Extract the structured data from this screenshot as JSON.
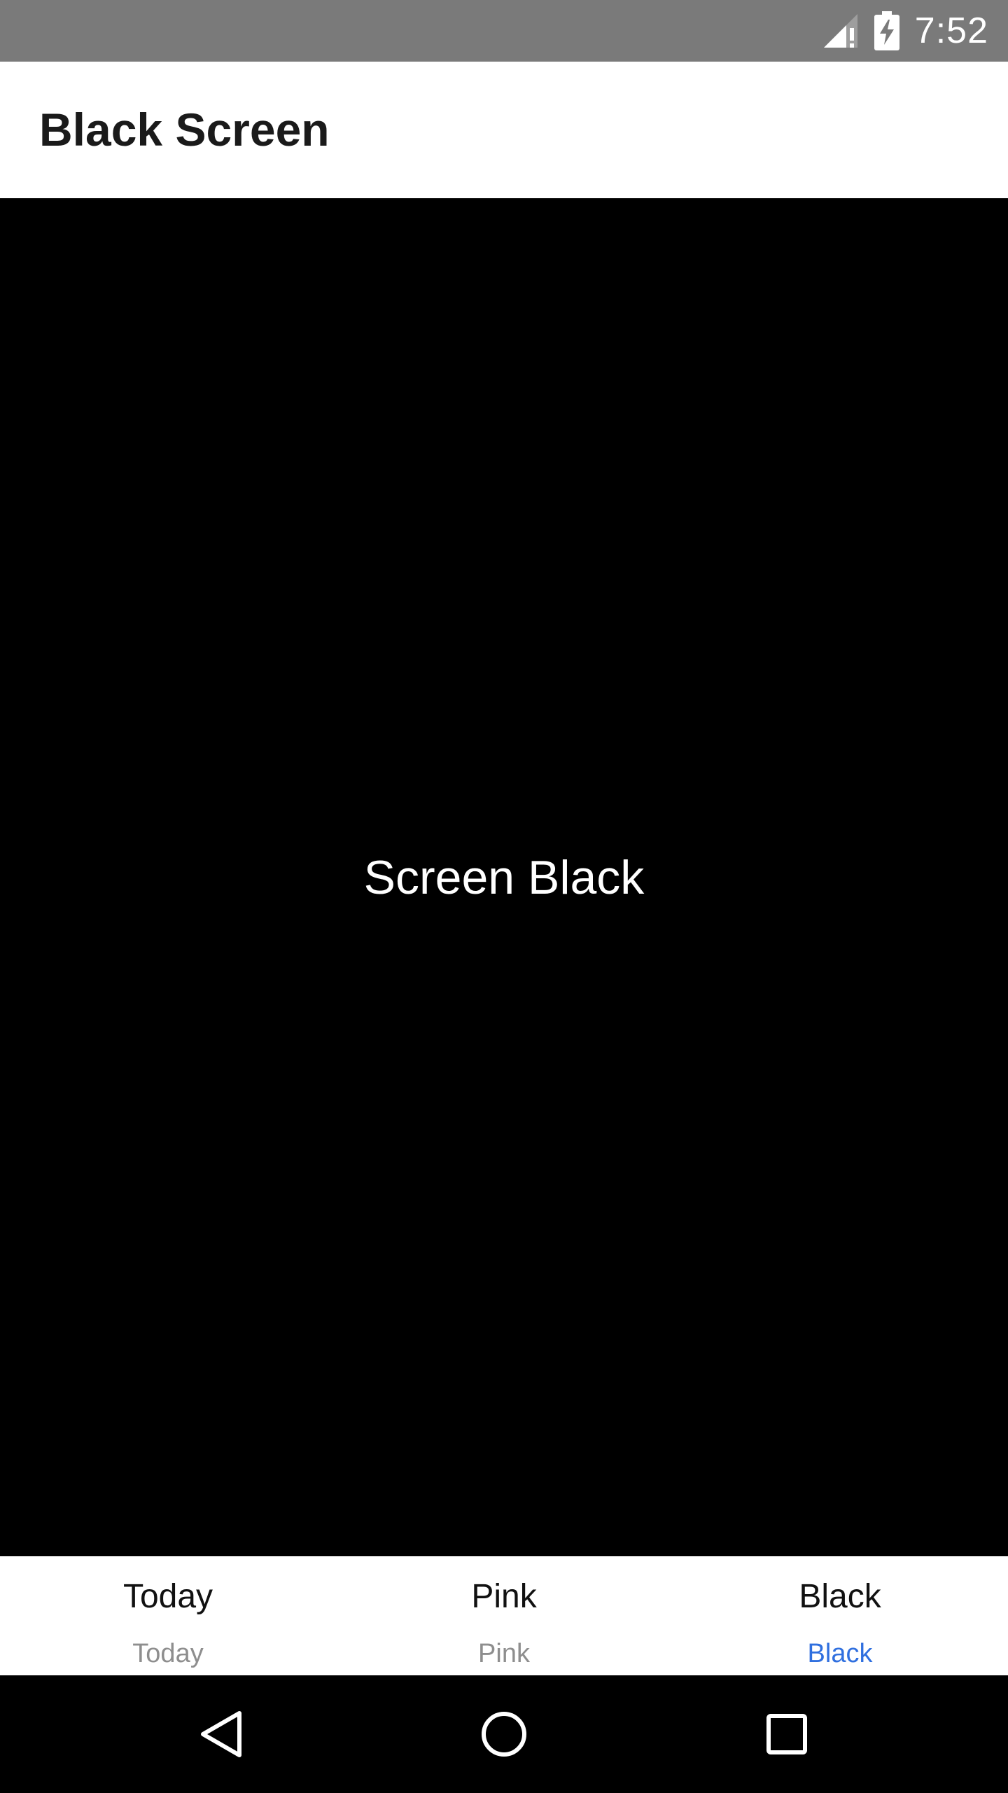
{
  "status_bar": {
    "time": "7:52",
    "icons": [
      "signal-no-data-icon",
      "battery-charging-icon"
    ]
  },
  "app_bar": {
    "title": "Black Screen"
  },
  "content": {
    "text": "Screen Black",
    "background": "#000000"
  },
  "tabs": [
    {
      "icon_text": "Today",
      "label": "Today",
      "active": false
    },
    {
      "icon_text": "Pink",
      "label": "Pink",
      "active": false
    },
    {
      "icon_text": "Black",
      "label": "Black",
      "active": true
    }
  ],
  "colors": {
    "active_tab": "#2f6fdf",
    "inactive_tab": "#8e8e8e",
    "status_bar": "#7a7a7a"
  },
  "nav_bar": {
    "buttons": [
      "back-icon",
      "home-icon",
      "recents-icon"
    ]
  }
}
